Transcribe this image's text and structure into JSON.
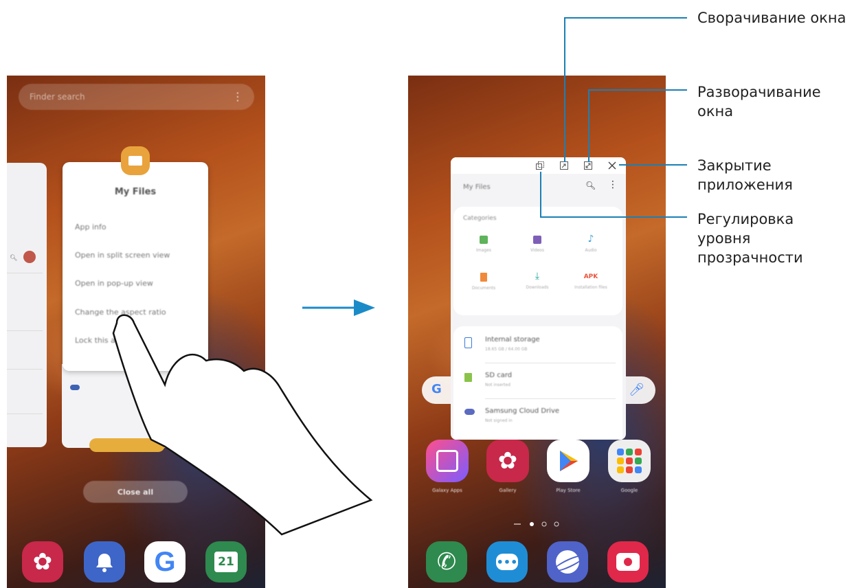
{
  "callouts": {
    "minimize": "Сворачивание окна",
    "maximize": "Разворачивание\nокна",
    "close": "Закрытие\nприложения",
    "opacity": "Регулировка\nуровня\nпрозрачности"
  },
  "left_phone": {
    "finder_placeholder": "Finder search",
    "menu_card": {
      "title": "My Files",
      "items": [
        "App info",
        "Open in split screen view",
        "Open in pop-up view",
        "Change the aspect ratio",
        "Lock this app"
      ]
    },
    "close_all": "Close all",
    "dock_calendar_date": "21"
  },
  "right_phone": {
    "popup_title": "My Files",
    "categories_header": "Categories",
    "categories": [
      {
        "label": "Images",
        "icon": "image-icon",
        "color": "#5fb35b"
      },
      {
        "label": "Videos",
        "icon": "video-icon",
        "color": "#7e5fb8"
      },
      {
        "label": "Audio",
        "icon": "audio-icon",
        "color": "#3aa0d6"
      },
      {
        "label": "Documents",
        "icon": "document-icon",
        "color": "#f08a3a"
      },
      {
        "label": "Downloads",
        "icon": "download-icon",
        "color": "#26a69a"
      },
      {
        "label": "Installation files",
        "icon": "apk-icon",
        "color": "#e8553c",
        "glyph": "APK"
      }
    ],
    "storage": [
      {
        "name": "Internal storage",
        "detail": "18.65 GB / 64.00 GB",
        "icon": "phone-storage-icon",
        "color": "#3b7bd6"
      },
      {
        "name": "SD card",
        "detail": "Not inserted",
        "icon": "sd-card-icon",
        "color": "#8bc34a"
      },
      {
        "name": "Samsung Cloud Drive",
        "detail": "Not signed in",
        "icon": "cloud-icon",
        "color": "#5c6bc0"
      }
    ],
    "home_apps": [
      "Galaxy Apps",
      "Gallery",
      "Play Store",
      "Google"
    ]
  }
}
